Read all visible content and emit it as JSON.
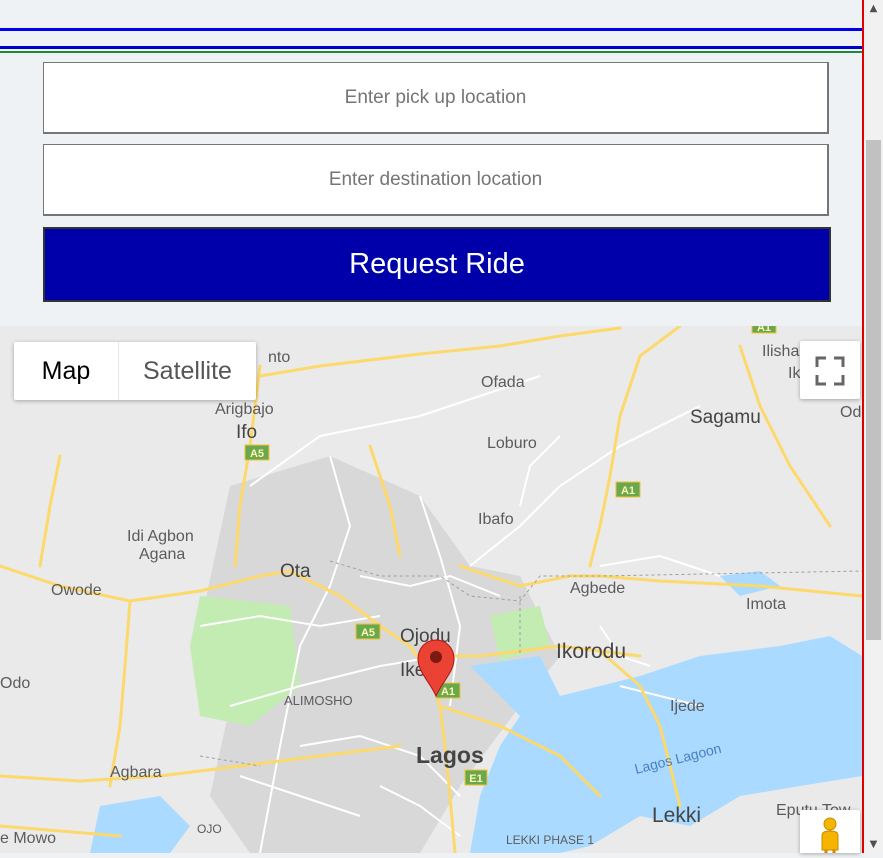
{
  "form": {
    "pickup_placeholder": "Enter pick up location",
    "destination_placeholder": "Enter destination location",
    "request_label": "Request Ride"
  },
  "map": {
    "type_options": [
      "Map",
      "Satellite"
    ],
    "selected_type": "Map",
    "labels": {
      "oronto": "nto",
      "ilisha": "Ilisha",
      "ik": "Ik",
      "od": "Od",
      "ofada": "Ofada",
      "sagamu": "Sagamu",
      "arigbajo": "Arigbajo",
      "ifo": "Ifo",
      "loburo": "Loburo",
      "ibafo": "Ibafo",
      "idi_agbon": "Idi Agbon",
      "agana": "Agana",
      "ota": "Ota",
      "agbede": "Agbede",
      "owode": "Owode",
      "imota": "Imota",
      "ojodu": "Ojodu",
      "ikeja": "Ike",
      "ikorodu": "Ikorodu",
      "odo": "Odo",
      "alimosho": "ALIMOSHO",
      "ijede": "Ijede",
      "lagos_lagoon": "Lagos Lagoon",
      "lagos": "Lagos",
      "agbara": "Agbara",
      "lekki": "Lekki",
      "eputu": "Eputu Tow",
      "mowo": "e Mowo",
      "ojo": "OJO",
      "lekki_phase": "LEKKI PHASE 1"
    },
    "road_shields": [
      "A1",
      "A5",
      "A5",
      "A1",
      "A1",
      "E1"
    ],
    "colors": {
      "land": "#eaeaea",
      "water": "#aadaff",
      "park": "#c3ecb2",
      "road_major": "#fdd86b",
      "marker": "#ea4335"
    }
  },
  "icons": {
    "fullscreen": "fullscreen-icon",
    "pegman": "pegman-icon",
    "marker": "location-marker-icon"
  }
}
